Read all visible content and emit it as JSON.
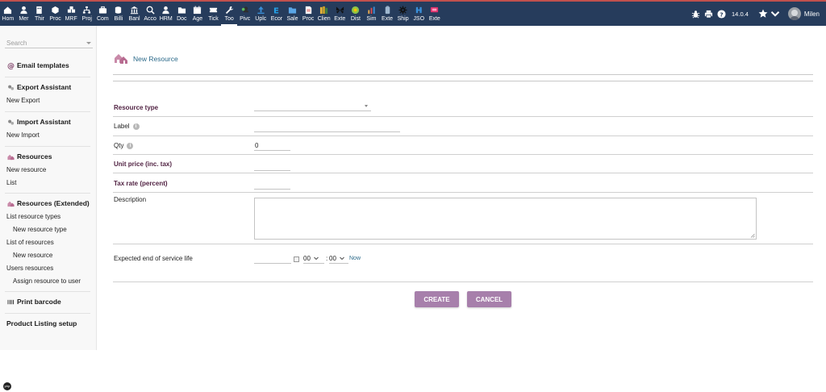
{
  "topbar": {
    "accent_color": "#263c5c",
    "top_border_color": "#c0504d",
    "items": [
      {
        "label": "Hom",
        "icon": "home-icon"
      },
      {
        "label": "Mer",
        "icon": "user-icon"
      },
      {
        "label": "Thir",
        "icon": "building-icon"
      },
      {
        "label": "Proc",
        "icon": "cube-icon"
      },
      {
        "label": "MRF",
        "icon": "cubes-icon"
      },
      {
        "label": "Proj",
        "icon": "sitemap-icon"
      },
      {
        "label": "Com",
        "icon": "suitcase-icon"
      },
      {
        "label": "Billi",
        "icon": "coins-icon"
      },
      {
        "label": "Banl",
        "icon": "bank-icon"
      },
      {
        "label": "Acco",
        "icon": "search-dollar-icon"
      },
      {
        "label": "HRM",
        "icon": "user-tie-icon"
      },
      {
        "label": "Doc",
        "icon": "folder-icon"
      },
      {
        "label": "Age",
        "icon": "calendar-icon"
      },
      {
        "label": "Tick",
        "icon": "ticket-icon"
      },
      {
        "label": "Too",
        "icon": "wrench-icon"
      },
      {
        "label": "Pivc",
        "icon": "user-group-icon"
      },
      {
        "label": "Uplc",
        "icon": "upload-icon"
      },
      {
        "label": "Ecor",
        "icon": "letter-e-icon"
      },
      {
        "label": "Sale",
        "icon": "folder-blue-icon"
      },
      {
        "label": "Proc",
        "icon": "document-icon"
      },
      {
        "label": "Clien",
        "icon": "books-icon"
      },
      {
        "label": "Exte",
        "icon": "butterfly-icon"
      },
      {
        "label": "Dist",
        "icon": "globe-icon"
      },
      {
        "label": "Sim",
        "icon": "bar-chart-icon"
      },
      {
        "label": "Exte",
        "icon": "battery-icon"
      },
      {
        "label": "Ship",
        "icon": "gear-icon"
      },
      {
        "label": "JSO",
        "icon": "user-tag-icon"
      },
      {
        "label": "Exte",
        "icon": "pink-flag-icon"
      }
    ],
    "active_index": 14,
    "version": "14.0.4",
    "user_name": "Milen"
  },
  "sidebar": {
    "search_placeholder": "Search",
    "sections": [
      {
        "title": "Email templates",
        "icon": "at-icon",
        "links": []
      },
      {
        "title": "Export Assistant",
        "icon": "gears-icon",
        "links": [
          {
            "label": "New Export",
            "sub": false
          }
        ]
      },
      {
        "title": "Import Assistant",
        "icon": "gears-icon",
        "links": [
          {
            "label": "New Import",
            "sub": false
          }
        ]
      },
      {
        "title": "Resources",
        "icon": "resource-icon",
        "links": [
          {
            "label": "New resource",
            "sub": false
          },
          {
            "label": "List",
            "sub": false
          }
        ]
      },
      {
        "title": "Resources (Extended)",
        "icon": "resource-icon",
        "links": [
          {
            "label": "List resource types",
            "sub": false
          },
          {
            "label": "New resource type",
            "sub": true
          },
          {
            "label": "List of resources",
            "sub": false
          },
          {
            "label": "New resource",
            "sub": true
          },
          {
            "label": "Users resources",
            "sub": false
          },
          {
            "label": "Assign resource to user",
            "sub": true
          }
        ]
      },
      {
        "title": "Print barcode",
        "icon": "barcode-icon",
        "links": []
      },
      {
        "title": "Product Listing setup",
        "icon": "",
        "links": []
      }
    ]
  },
  "page": {
    "title": "New Resource",
    "title_color": "#2c6a8a",
    "label_color": "#522444"
  },
  "form": {
    "resource_type_label": "Resource type",
    "resource_type_value": "",
    "label_label": "Label",
    "label_value": "",
    "qty_label": "Qty",
    "qty_value": "0",
    "unit_price_label": "Unit price (inc. tax)",
    "unit_price_value": "",
    "tax_rate_label": "Tax rate (percent)",
    "tax_rate_value": "",
    "description_label": "Description",
    "description_value": "",
    "end_of_life_label": "Expected end of service life",
    "date_value": "",
    "hour_value": "00",
    "minute_value": "00",
    "now_label": "Now"
  },
  "buttons": {
    "create_label": "CREATE",
    "cancel_label": "CANCEL",
    "color": "#a77fab"
  }
}
